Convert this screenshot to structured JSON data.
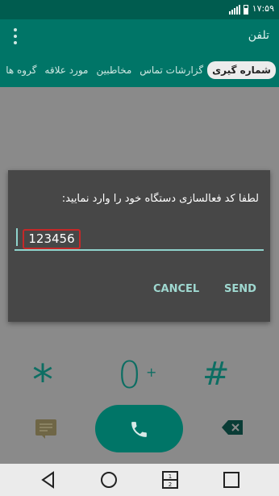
{
  "statusbar": {
    "time": "۱۷:۵۹"
  },
  "appbar": {
    "title": "تلفن"
  },
  "tabs": [
    {
      "label": "شماره گیری"
    },
    {
      "label": "گزارشات تماس"
    },
    {
      "label": "مخاطبین"
    },
    {
      "label": "مورد علاقه"
    },
    {
      "label": "گروه ها"
    }
  ],
  "dialog": {
    "message": "لطفا کد فعالسازی دستگاه خود را وارد نمایید:",
    "input_value": "123456",
    "cancel_label": "CANCEL",
    "send_label": "SEND"
  },
  "dialpad": {
    "star": "*",
    "zero": "0",
    "plus": "+",
    "hash": "#"
  },
  "icons": {
    "menu": "more-vert-icon",
    "message": "message-icon",
    "call": "phone-icon",
    "backspace": "backspace-icon",
    "back": "back-icon",
    "home": "home-icon",
    "dual_window": "dual-window-icon",
    "recents": "recents-icon"
  },
  "colors": {
    "primary": "#007567",
    "accent": "#9fd8d0",
    "error_box": "#c62828"
  }
}
